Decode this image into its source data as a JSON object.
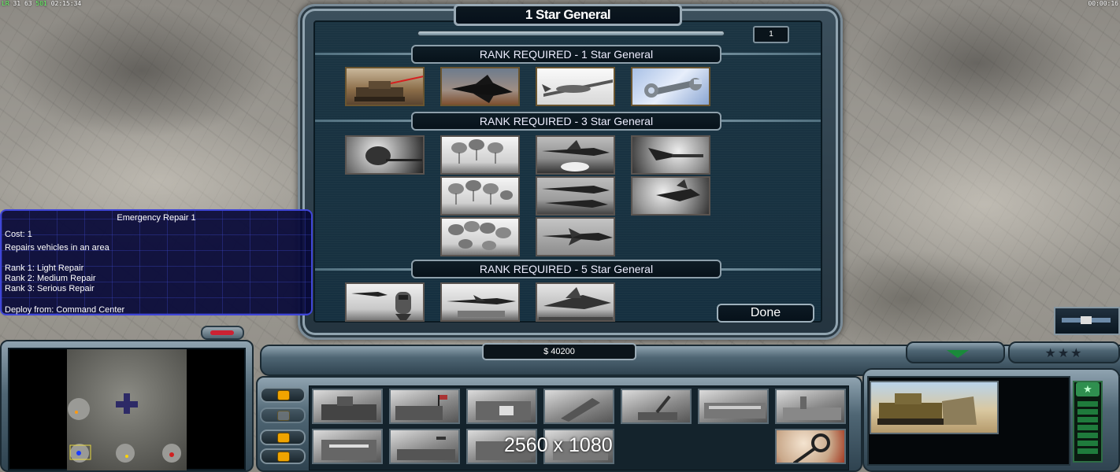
{
  "debug": {
    "top_left_prefix": "LR",
    "top_left_a": "31",
    "top_left_b": "63",
    "top_left_c": "501",
    "top_left_time": "02:15:34",
    "top_right_time": "00:00:16"
  },
  "generals_promotion": {
    "title": "1 Star General",
    "rank_points": "1",
    "sections": [
      {
        "header": "RANK REQUIRED - 1 Star General"
      },
      {
        "header": "RANK REQUIRED - 3 Star General"
      },
      {
        "header": "RANK REQUIRED - 5 Star General"
      }
    ],
    "done_label": "Done"
  },
  "tooltip": {
    "title": "Emergency Repair 1",
    "cost": "Cost: 1",
    "description": "Repairs vehicles in an area",
    "rank1": "Rank 1: Light Repair",
    "rank2": "Rank 2: Medium Repair",
    "rank3": "Rank 3: Serious Repair",
    "deploy": "Deploy from: Command Center"
  },
  "hud": {
    "money": "$ 40200",
    "resolution_overlay": "2560 x 1080"
  },
  "colors": {
    "tooltip_border": "#3f46d8",
    "health_green": "#1f7b3c",
    "accent_orange": "#f0a400"
  }
}
